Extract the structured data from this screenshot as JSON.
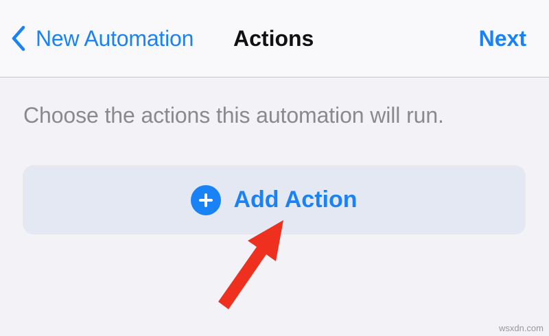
{
  "nav": {
    "back_label": "New Automation",
    "title": "Actions",
    "next_label": "Next"
  },
  "main": {
    "instructions": "Choose the actions this automation will run.",
    "add_action_label": "Add Action"
  },
  "icons": {
    "back": "chevron-left-icon",
    "add": "plus-circle-icon",
    "annotation": "red-arrow-icon"
  },
  "colors": {
    "accent": "#1a82f7",
    "annotation": "#f0301e",
    "background": "#f2f2f7",
    "button_background": "#e3e8f3"
  },
  "watermark": "wsxdn.com"
}
